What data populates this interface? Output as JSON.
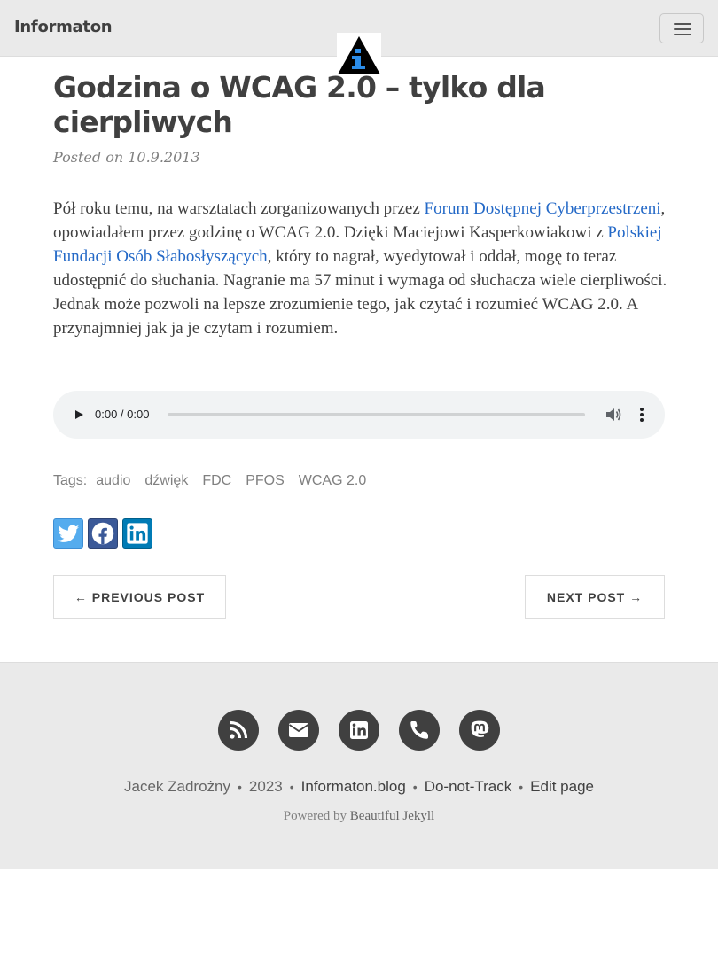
{
  "navbar": {
    "brand": "Informaton"
  },
  "post": {
    "title": "Godzina o WCAG 2.0 – tylko dla cierpliwych",
    "meta": "Posted on 10.9.2013",
    "body": {
      "t1": "Pół roku temu, na warsztatach zorganizowanych przez ",
      "link1": "Forum Dostępnej Cyberprzestrzeni",
      "t2": ", opowiadałem przez godzinę o WCAG 2.0. Dzięki Maciejowi Kasperkowiakowi z ",
      "link2": "Polskiej Fundacji Osób Słabosłyszących",
      "t3": ", który to nagrał, wyedytował i oddał, mogę to teraz udostępnić do słuchania. Nagranie ma 57 minut i wymaga od słuchacza wiele cierpliwości. Jednak może pozwoli na lepsze zrozumienie tego, jak czytać i rozumieć WCAG 2.0. A przynajmniej jak ja je czytam i rozumiem."
    }
  },
  "audio": {
    "time": "0:00 / 0:00",
    "progress": 0
  },
  "tags": {
    "label": "Tags:",
    "items": [
      "audio",
      "dźwięk",
      "FDC",
      "PFOS",
      "WCAG 2.0"
    ]
  },
  "share": {
    "icons": [
      "twitter-icon",
      "facebook-icon",
      "linkedin-icon"
    ]
  },
  "pager": {
    "prev": "← PREVIOUS POST",
    "next": "NEXT POST →"
  },
  "footer": {
    "social_icons": [
      "rss-icon",
      "envelope-icon",
      "linkedin-icon",
      "phone-icon",
      "mastodon-icon"
    ],
    "author": "Jacek Zadrożny",
    "year": "2023",
    "site": "Informaton.blog",
    "dnt": "Do-not-Track",
    "edit": "Edit page",
    "powered_prefix": "Powered by",
    "powered_link": "Beautiful Jekyll"
  },
  "colors": {
    "link": "#2469c7",
    "navbar_bg": "#eaeaea",
    "footer_bg": "#eaeaea",
    "text": "#404040"
  }
}
